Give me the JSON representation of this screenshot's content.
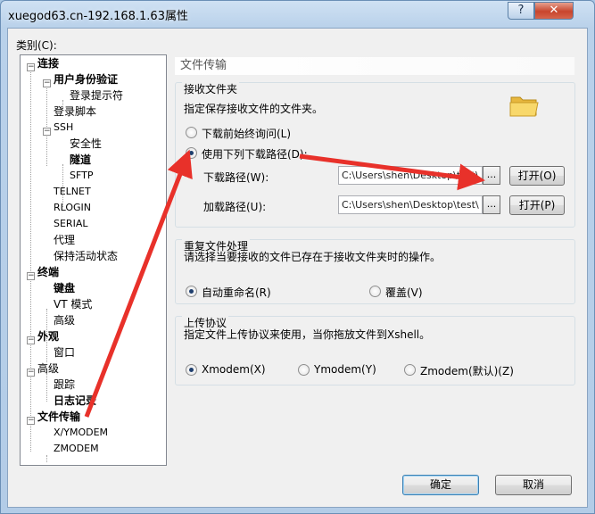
{
  "window": {
    "title": "xuegod63.cn-192.168.1.63属性",
    "help_label": "?",
    "close_label": "✕"
  },
  "category_label": "类别(C):",
  "tree": [
    {
      "label": "连接"
    },
    {
      "label": "用户身份验证"
    },
    {
      "label": "登录提示符"
    },
    {
      "label": "登录脚本"
    },
    {
      "label": "SSH"
    },
    {
      "label": "安全性"
    },
    {
      "label": "隧道"
    },
    {
      "label": "SFTP"
    },
    {
      "label": "TELNET"
    },
    {
      "label": "RLOGIN"
    },
    {
      "label": "SERIAL"
    },
    {
      "label": "代理"
    },
    {
      "label": "保持活动状态"
    },
    {
      "label": "终端"
    },
    {
      "label": "键盘"
    },
    {
      "label": "VT 模式"
    },
    {
      "label": "高级"
    },
    {
      "label": "外观"
    },
    {
      "label": "窗口"
    },
    {
      "label": "高级"
    },
    {
      "label": "跟踪"
    },
    {
      "label": "日志记录"
    },
    {
      "label": "文件传输"
    },
    {
      "label": "X/YMODEM"
    },
    {
      "label": "ZMODEM"
    }
  ],
  "tree_expander_symbol": "−",
  "section_title": "文件传输",
  "receive": {
    "title": "接收文件夹",
    "desc": "指定保存接收文件的文件夹。",
    "opt_ask": "下载前始终询问(L)",
    "opt_path": "使用下列下载路径(D):",
    "download_label": "下载路径(W):",
    "download_value": "C:\\Users\\shen\\Desktop\\test\\",
    "upload_label": "加载路径(U):",
    "upload_value": "C:\\Users\\shen\\Desktop\\test\\",
    "browse_label": "...",
    "open1_label": "打开(O)",
    "open2_label": "打开(P)"
  },
  "duplicate": {
    "title": "重复文件处理",
    "desc": "请选择当要接收的文件已存在于接收文件夹时的操作。",
    "opt_rename": "自动重命名(R)",
    "opt_overwrite": "覆盖(V)"
  },
  "upload_protocol": {
    "title": "上传协议",
    "desc": "指定文件上传协议来使用，当你拖放文件到Xshell。",
    "opt_x": "Xmodem(X)",
    "opt_y": "Ymodem(Y)",
    "opt_z": "Zmodem(默认)(Z)"
  },
  "buttons": {
    "ok": "确定",
    "cancel": "取消"
  },
  "colors": {
    "arrow": "#e8312a",
    "accent": "#3c7fb1"
  }
}
